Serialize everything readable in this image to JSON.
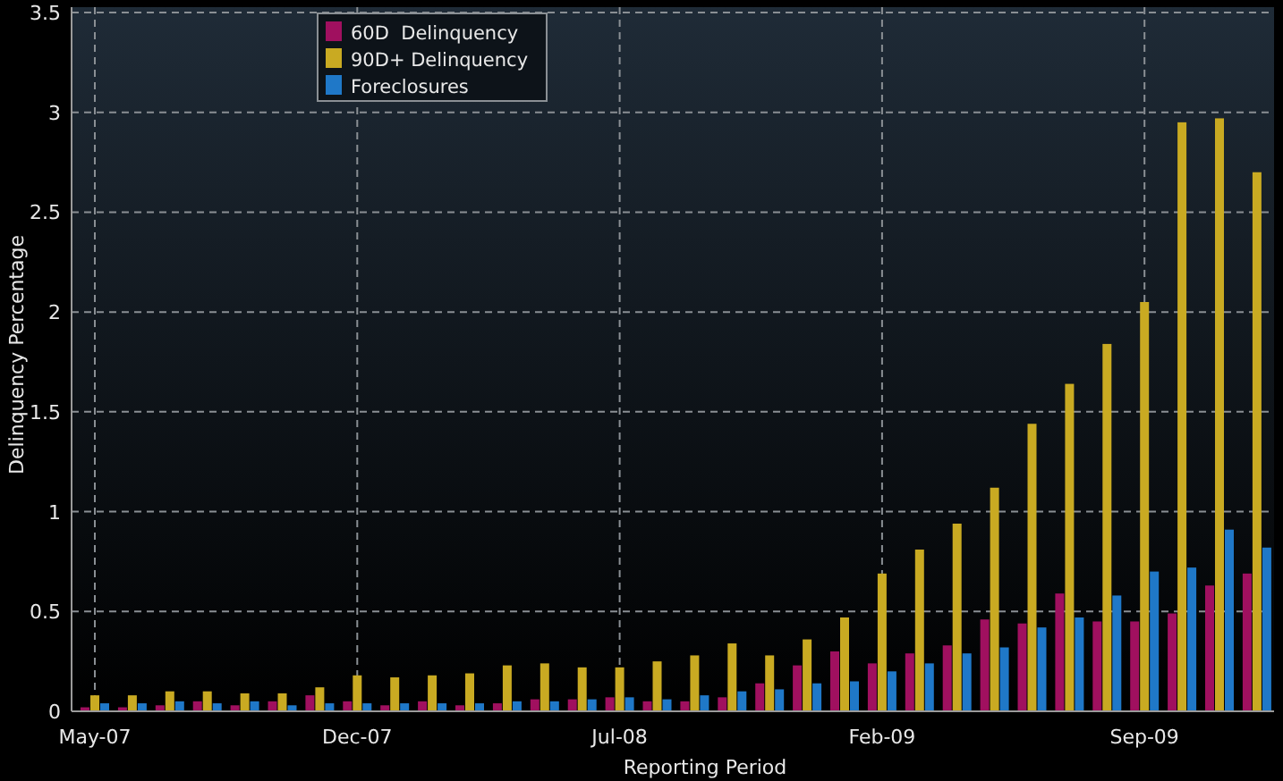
{
  "chart": {
    "chart_data": {
      "type": "bar",
      "xlabel": "Reporting Period",
      "ylabel": "Delinquency Percentage",
      "categories": [
        "May-07",
        null,
        null,
        null,
        null,
        null,
        null,
        "Dec-07",
        null,
        null,
        null,
        null,
        null,
        null,
        "Jul-08",
        null,
        null,
        null,
        null,
        null,
        null,
        "Feb-09",
        null,
        null,
        null,
        null,
        null,
        null,
        "Sep-09",
        null,
        null,
        null
      ],
      "grid": true,
      "legend": true,
      "series": [
        {
          "name": "60D  Delinquency",
          "color": "#a0105f",
          "values": [
            0.02,
            0.02,
            0.03,
            0.05,
            0.03,
            0.05,
            0.08,
            0.05,
            0.03,
            0.05,
            0.03,
            0.04,
            0.06,
            0.06,
            0.07,
            0.05,
            0.05,
            0.07,
            0.14,
            0.23,
            0.3,
            0.24,
            0.29,
            0.33,
            0.46,
            0.44,
            0.59,
            0.45,
            0.45,
            0.49,
            0.63,
            0.69
          ]
        },
        {
          "name": "90D+ Delinquency",
          "color": "#c9aa22",
          "values": [
            0.08,
            0.08,
            0.1,
            0.1,
            0.09,
            0.09,
            0.12,
            0.18,
            0.17,
            0.18,
            0.19,
            0.23,
            0.24,
            0.22,
            0.22,
            0.25,
            0.28,
            0.34,
            0.28,
            0.36,
            0.47,
            0.69,
            0.81,
            0.94,
            1.12,
            1.44,
            1.64,
            1.84,
            2.05,
            2.95,
            2.97,
            2.7
          ]
        },
        {
          "name": "Foreclosures",
          "color": "#1f78c8",
          "values": [
            0.04,
            0.04,
            0.05,
            0.04,
            0.05,
            0.03,
            0.04,
            0.04,
            0.04,
            0.04,
            0.04,
            0.05,
            0.05,
            0.06,
            0.07,
            0.06,
            0.08,
            0.1,
            0.11,
            0.14,
            0.15,
            0.2,
            0.24,
            0.29,
            0.32,
            0.42,
            0.47,
            0.58,
            0.7,
            0.72,
            0.91,
            0.82
          ]
        }
      ],
      "ylim": [
        0,
        3.5
      ],
      "yticks": [
        0,
        0.5,
        1,
        1.5,
        2,
        2.5,
        3,
        3.5
      ]
    }
  }
}
